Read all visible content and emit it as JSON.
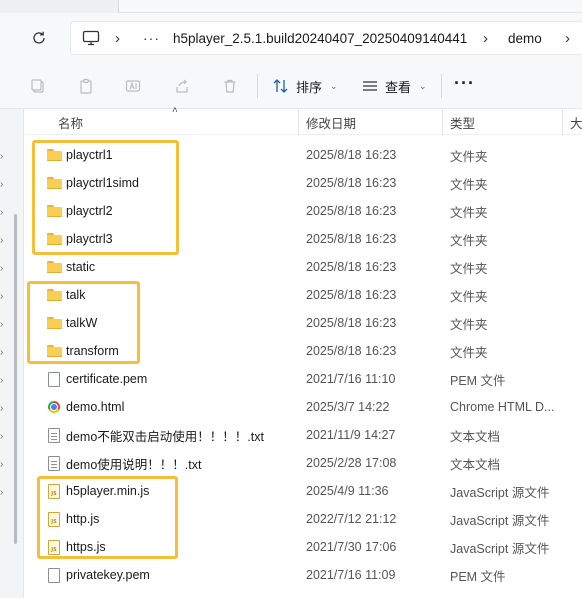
{
  "address_bar": {
    "more_label": "···",
    "breadcrumbs": [
      "h5player_2.5.1.build20240407_20250409140441",
      "demo"
    ]
  },
  "toolbar": {
    "sort_label": "排序",
    "view_label": "查看",
    "more_label": "···"
  },
  "columns": {
    "name": "名称",
    "date": "修改日期",
    "type": "类型",
    "size": "大"
  },
  "files": [
    {
      "icon": "folder-icon",
      "name": "playctrl1",
      "date": "2025/8/18 16:23",
      "type": "文件夹"
    },
    {
      "icon": "folder-icon",
      "name": "playctrl1simd",
      "date": "2025/8/18 16:23",
      "type": "文件夹"
    },
    {
      "icon": "folder-icon",
      "name": "playctrl2",
      "date": "2025/8/18 16:23",
      "type": "文件夹"
    },
    {
      "icon": "folder-icon",
      "name": "playctrl3",
      "date": "2025/8/18 16:23",
      "type": "文件夹"
    },
    {
      "icon": "folder-icon",
      "name": "static",
      "date": "2025/8/18 16:23",
      "type": "文件夹"
    },
    {
      "icon": "folder-icon",
      "name": "talk",
      "date": "2025/8/18 16:23",
      "type": "文件夹"
    },
    {
      "icon": "folder-icon",
      "name": "talkW",
      "date": "2025/8/18 16:23",
      "type": "文件夹"
    },
    {
      "icon": "folder-icon",
      "name": "transform",
      "date": "2025/8/18 16:23",
      "type": "文件夹"
    },
    {
      "icon": "file-icon",
      "name": "certificate.pem",
      "date": "2021/7/16 11:10",
      "type": "PEM 文件"
    },
    {
      "icon": "chrome-html-icon",
      "name": "demo.html",
      "date": "2025/3/7 14:22",
      "type": "Chrome HTML D..."
    },
    {
      "icon": "text-file-icon",
      "name": "demo不能双击启动使用！！！！.txt",
      "date": "2021/11/9 14:27",
      "type": "文本文档"
    },
    {
      "icon": "text-file-icon",
      "name": "demo使用说明！！！.txt",
      "date": "2025/2/28 17:08",
      "type": "文本文档"
    },
    {
      "icon": "js-file-icon",
      "name": "h5player.min.js",
      "date": "2025/4/9 11:36",
      "type": "JavaScript 源文件"
    },
    {
      "icon": "js-file-icon",
      "name": "http.js",
      "date": "2022/7/12 21:12",
      "type": "JavaScript 源文件"
    },
    {
      "icon": "js-file-icon",
      "name": "https.js",
      "date": "2021/7/30 17:06",
      "type": "JavaScript 源文件"
    },
    {
      "icon": "file-icon",
      "name": "privatekey.pem",
      "date": "2021/7/16 11:09",
      "type": "PEM 文件"
    }
  ],
  "highlight_color": "#f5bf3a"
}
